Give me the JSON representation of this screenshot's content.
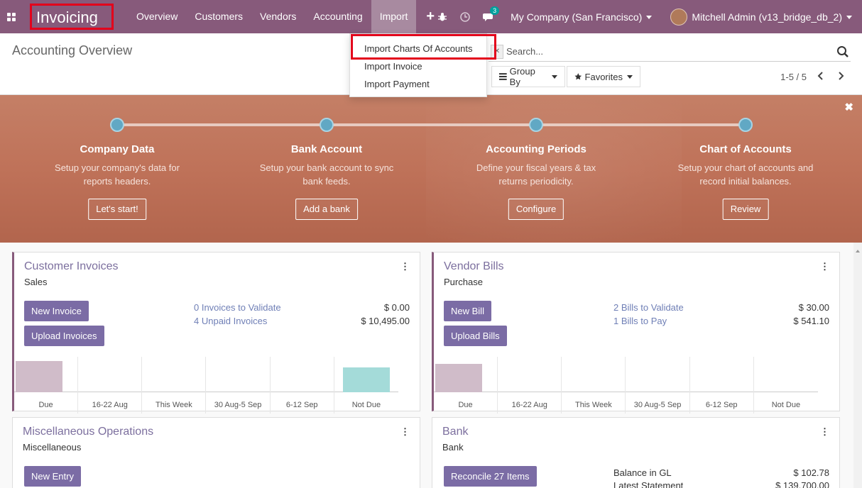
{
  "navbar": {
    "app_title": "Invoicing",
    "menu": [
      "Overview",
      "Customers",
      "Vendors",
      "Accounting",
      "Import"
    ],
    "plus": "+",
    "chat_badge": "3",
    "company": "My Company (San Francisco)",
    "user": "Mitchell Admin (v13_bridge_db_2)"
  },
  "import_menu": {
    "items": [
      "Import Charts Of Accounts",
      "Import Invoice",
      "Import Payment"
    ]
  },
  "control_panel": {
    "title": "Accounting Overview",
    "search_placeholder": "Search...",
    "group_by": "Group By",
    "favorites": "Favorites",
    "pager": "1-5 / 5"
  },
  "onboarding": {
    "steps": [
      {
        "title": "Company Data",
        "desc": "Setup your company's data for reports headers.",
        "button": "Let's start!"
      },
      {
        "title": "Bank Account",
        "desc": "Setup your bank account to sync bank feeds.",
        "button": "Add a bank"
      },
      {
        "title": "Accounting Periods",
        "desc": "Define your fiscal years & tax returns periodicity.",
        "button": "Configure"
      },
      {
        "title": "Chart of Accounts",
        "desc": "Setup your chart of accounts and record initial balances.",
        "button": "Review"
      }
    ]
  },
  "journals": {
    "customer_invoices": {
      "title": "Customer Invoices",
      "subtitle": "Sales",
      "primary_button": "New Invoice",
      "secondary_button": "Upload Invoices",
      "stats": [
        {
          "label": "0 Invoices to Validate",
          "value": "$ 0.00"
        },
        {
          "label": "4 Unpaid Invoices",
          "value": "$ 10,495.00"
        }
      ],
      "graph_labels": [
        "Due",
        "16-22 Aug",
        "This Week",
        "30 Aug-5 Sep",
        "6-12 Sep",
        "Not Due"
      ],
      "graph_values": [
        0.55,
        0,
        0,
        0,
        0,
        0.44
      ]
    },
    "vendor_bills": {
      "title": "Vendor Bills",
      "subtitle": "Purchase",
      "primary_button": "New Bill",
      "secondary_button": "Upload Bills",
      "stats": [
        {
          "label": "2 Bills to Validate",
          "value": "$ 30.00"
        },
        {
          "label": "1 Bills to Pay",
          "value": "$ 541.10"
        }
      ],
      "graph_labels": [
        "Due",
        "16-22 Aug",
        "This Week",
        "30 Aug-5 Sep",
        "6-12 Sep",
        "Not Due"
      ],
      "graph_values": [
        0.5,
        0,
        0,
        0,
        0,
        0
      ]
    },
    "misc": {
      "title": "Miscellaneous Operations",
      "subtitle": "Miscellaneous",
      "primary_button": "New Entry"
    },
    "bank": {
      "title": "Bank",
      "subtitle": "Bank",
      "primary_button": "Reconcile 27 Items",
      "stats": [
        {
          "label": "Balance in GL",
          "value": "$ 102.78"
        },
        {
          "label": "Latest Statement",
          "value": "$ 139,700.00"
        }
      ]
    }
  },
  "colors": {
    "navbar": "#875a7b",
    "accent_button": "#7b6ca5",
    "highlight_box": "#e3001b",
    "graph_past": "#d0bcc9",
    "graph_future": "#a4dbd9"
  }
}
